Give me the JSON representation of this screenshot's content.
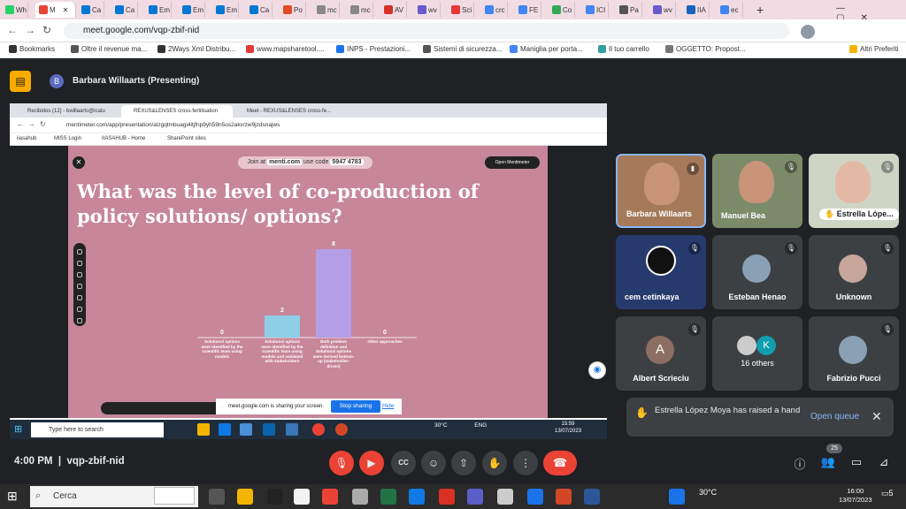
{
  "outer_browser": {
    "tabs": [
      "Wh",
      "M",
      "Ca",
      "Ca",
      "Em",
      "Em",
      "Em",
      "Ca",
      "Po",
      "mc",
      "mc",
      "AV",
      "wv",
      "Sci",
      "crc",
      "FE",
      "Co",
      "ICI",
      "Pa",
      "wv",
      "IIA",
      "ec"
    ],
    "url": "meet.google.com/vqp-zbif-nid",
    "bookmarks": [
      "Bookmarks",
      "Oltre il revenue ma...",
      "2Ways Xml Distribu...",
      "www.mapsharetool....",
      "INPS - Prestazioni...",
      "Sistemi di sicurezza...",
      "Maniglia per porta...",
      "Il tuo carrello",
      "OGGETTO: Propost...",
      "Altri Preferiti"
    ]
  },
  "meet": {
    "presenter_initial": "B",
    "presenter_title": "Barbara Willaarts (Presenting)",
    "time": "4:00 PM",
    "meeting_code": "vqp-zbif-nid",
    "participant_count": "25",
    "participants": [
      {
        "name": "Barbara Willaarts",
        "kind": "video"
      },
      {
        "name": "Manuel Bea",
        "kind": "video"
      },
      {
        "name": "Estrella Lópe...",
        "kind": "video"
      },
      {
        "name": "cem cetinkaya",
        "kind": "video"
      },
      {
        "name": "Esteban Henao",
        "kind": "photo"
      },
      {
        "name": "Unknown",
        "kind": "avatar"
      },
      {
        "name": "Albert Scrieciu",
        "kind": "initial",
        "initial": "A"
      },
      {
        "name": "16 others",
        "kind": "group",
        "initial": "K"
      },
      {
        "name": "Fabrizio Pucci",
        "kind": "photo"
      }
    ],
    "hand_notification": "Estrella López Moya has raised a hand",
    "open_queue": "Open queue"
  },
  "shared_screen": {
    "tabs": [
      "Recibidos (12) - bwillaarts@icatu",
      "REXUS&LENSES cross-fertilisation",
      "Meet - REXUS&LENSES cross-fe..."
    ],
    "url": "mentimeter.com/app/presentation/alzgqtmbuagi4itjfnp9yh59n5os2akv/zw9jzdsnajws",
    "bookmarks": [
      "iiasahub",
      "MISS Login",
      "IIASAHUB - Home",
      "SharePoint sites"
    ],
    "join_prefix": "Join at",
    "join_site": "menti.com",
    "join_mid": "use code",
    "join_code": "5947 4783",
    "open_mentimeter": "Open Mentimeter",
    "question": "What was the level of co-production of policy solutions/ options?",
    "share_notice": "meet.google.com is sharing your screen.",
    "stop_sharing": "Stop sharing",
    "hide": "Hide",
    "taskbar_search": "Type here to search",
    "tray_temp": "30°C",
    "tray_lang": "ENG",
    "tray_time": "15:59",
    "tray_date": "13/07/2023"
  },
  "chart_data": {
    "type": "bar",
    "categories": [
      "Solutions/ options were identified by the scientific team using models",
      "Solutions/ options were identified by the scientific team using models and validated with stakeholders",
      "Both problem definition and Solutions/ options were derived bottom-up (stakeholder-driven)",
      "Other approaches"
    ],
    "values": [
      0,
      2,
      8,
      0
    ],
    "colors": [
      "#9fd0e8",
      "#8ecfe6",
      "#b59ee8",
      "#b59ee8"
    ],
    "ylim": [
      0,
      8
    ]
  },
  "windows": {
    "search": "Cerca",
    "temp": "30°C",
    "time": "16:00",
    "date": "13/07/2023",
    "notif": "5"
  }
}
